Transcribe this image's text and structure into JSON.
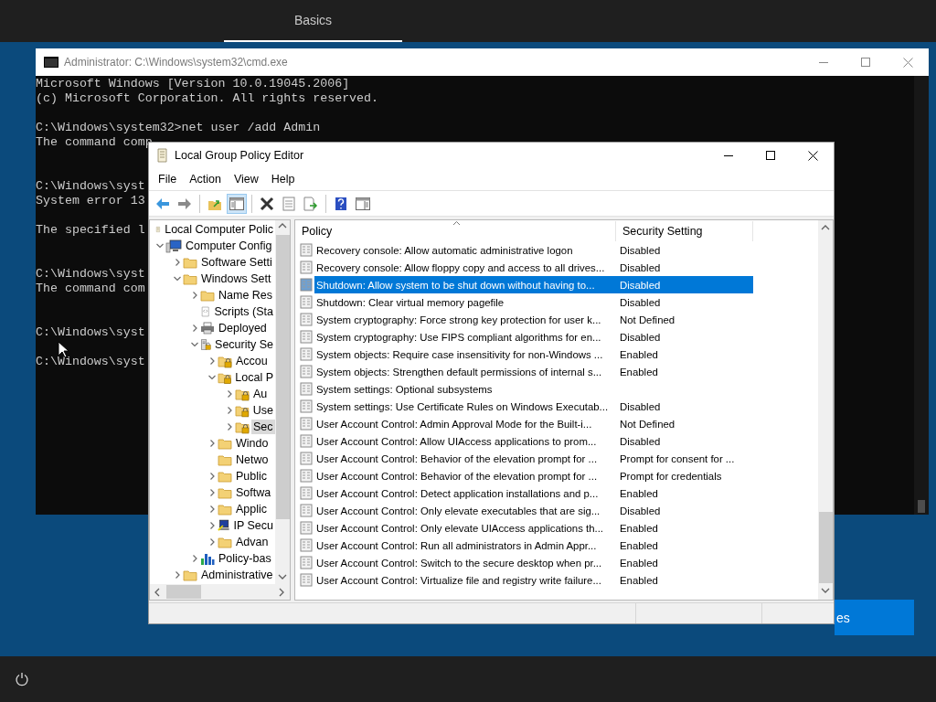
{
  "top_bar": {
    "tabs": [
      {
        "label": "Basics",
        "selected": true
      }
    ]
  },
  "cmd_window": {
    "title": "Administrator: C:\\Windows\\system32\\cmd.exe",
    "lines": [
      {
        "kind": "text",
        "text": "Microsoft Windows [Version 10.0.19045.2006]"
      },
      {
        "kind": "text",
        "text": "(c) Microsoft Corporation. All rights reserved."
      },
      {
        "kind": "blank"
      },
      {
        "kind": "text",
        "text": "C:\\Windows\\system32>net user /add Admin"
      },
      {
        "kind": "text",
        "text": "The command comp"
      },
      {
        "kind": "blank"
      },
      {
        "kind": "blank"
      },
      {
        "kind": "text",
        "text": "C:\\Windows\\syst"
      },
      {
        "kind": "text",
        "text": "System error 13"
      },
      {
        "kind": "blank"
      },
      {
        "kind": "text",
        "text": "The specified l"
      },
      {
        "kind": "blank"
      },
      {
        "kind": "blank"
      },
      {
        "kind": "text",
        "text": "C:\\Windows\\syst"
      },
      {
        "kind": "text",
        "text": "The command com"
      },
      {
        "kind": "blank"
      },
      {
        "kind": "blank"
      },
      {
        "kind": "text",
        "text": "C:\\Windows\\syst"
      },
      {
        "kind": "blank"
      },
      {
        "kind": "text",
        "text": "C:\\Windows\\syst"
      }
    ]
  },
  "background_button": {
    "label": "es"
  },
  "gpedit": {
    "title": "Local Group Policy Editor",
    "menu": [
      "File",
      "Action",
      "View",
      "Help"
    ],
    "toolbar": [
      {
        "kind": "back",
        "pressed": false
      },
      {
        "kind": "forward",
        "pressed": false
      },
      {
        "kind": "separator"
      },
      {
        "kind": "up",
        "pressed": false
      },
      {
        "kind": "tree-toggle",
        "pressed": true
      },
      {
        "kind": "separator"
      },
      {
        "kind": "delete",
        "pressed": false
      },
      {
        "kind": "properties",
        "pressed": false
      },
      {
        "kind": "export",
        "pressed": false
      },
      {
        "kind": "separator"
      },
      {
        "kind": "help",
        "pressed": false
      },
      {
        "kind": "view",
        "pressed": false
      }
    ],
    "tree": [
      {
        "label": "Local Computer Polic",
        "kind": "document",
        "selected": false,
        "children": [
          {
            "label": "Computer Config",
            "kind": "computer",
            "expanded": true,
            "selected": false,
            "children": [
              {
                "label": "Software Setti",
                "kind": "folder",
                "expanded": false,
                "selected": false
              },
              {
                "label": "Windows Sett",
                "kind": "folder",
                "expanded": true,
                "selected": false,
                "children": [
                  {
                    "label": "Name Res",
                    "kind": "folder",
                    "expanded": false,
                    "selected": false
                  },
                  {
                    "label": "Scripts (Sta",
                    "kind": "script",
                    "selected": false
                  },
                  {
                    "label": "Deployed",
                    "kind": "printer",
                    "expanded": false,
                    "selected": false
                  },
                  {
                    "label": "Security Se",
                    "kind": "secure-tool",
                    "expanded": true,
                    "selected": false,
                    "children": [
                      {
                        "label": "Accou",
                        "kind": "secure-folder",
                        "expanded": false,
                        "selected": false
                      },
                      {
                        "label": "Local P",
                        "kind": "secure-folder",
                        "expanded": true,
                        "selected": false,
                        "children": [
                          {
                            "label": "Au",
                            "kind": "secure-folder",
                            "expanded": false,
                            "selected": false
                          },
                          {
                            "label": "Use",
                            "kind": "secure-folder",
                            "expanded": false,
                            "selected": false
                          },
                          {
                            "label": "Sec",
                            "kind": "secure-folder",
                            "expanded": false,
                            "selected": true
                          }
                        ]
                      },
                      {
                        "label": "Windo",
                        "kind": "folder",
                        "expanded": false,
                        "selected": false
                      },
                      {
                        "label": "Netwo",
                        "kind": "folder",
                        "selected": false
                      },
                      {
                        "label": "Public",
                        "kind": "folder",
                        "expanded": false,
                        "selected": false
                      },
                      {
                        "label": "Softwa",
                        "kind": "folder",
                        "expanded": false,
                        "selected": false
                      },
                      {
                        "label": "Applic",
                        "kind": "folder",
                        "expanded": false,
                        "selected": false
                      },
                      {
                        "label": "IP Secu",
                        "kind": "network",
                        "expanded": false,
                        "selected": false
                      },
                      {
                        "label": "Advan",
                        "kind": "folder",
                        "expanded": false,
                        "selected": false
                      }
                    ]
                  },
                  {
                    "label": "Policy-bas",
                    "kind": "chart",
                    "expanded": false,
                    "selected": false
                  }
                ]
              },
              {
                "label": "Administrative",
                "kind": "folder",
                "expanded": false,
                "selected": false
              }
            ]
          }
        ]
      }
    ],
    "columns": [
      "Policy",
      "Security Setting"
    ],
    "rows": [
      {
        "policy": "Recovery console: Allow automatic administrative logon",
        "setting": "Disabled",
        "selected": false
      },
      {
        "policy": "Recovery console: Allow floppy copy and access to all drives...",
        "setting": "Disabled",
        "selected": false
      },
      {
        "policy": "Shutdown: Allow system to be shut down without having to...",
        "setting": "Disabled",
        "selected": true
      },
      {
        "policy": "Shutdown: Clear virtual memory pagefile",
        "setting": "Disabled",
        "selected": false
      },
      {
        "policy": "System cryptography: Force strong key protection for user k...",
        "setting": "Not Defined",
        "selected": false
      },
      {
        "policy": "System cryptography: Use FIPS compliant algorithms for en...",
        "setting": "Disabled",
        "selected": false
      },
      {
        "policy": "System objects: Require case insensitivity for non-Windows ...",
        "setting": "Enabled",
        "selected": false
      },
      {
        "policy": "System objects: Strengthen default permissions of internal s...",
        "setting": "Enabled",
        "selected": false
      },
      {
        "policy": "System settings: Optional subsystems",
        "selected": false
      },
      {
        "policy": "System settings: Use Certificate Rules on Windows Executab...",
        "setting": "Disabled",
        "selected": false
      },
      {
        "policy": "User Account Control: Admin Approval Mode for the Built-i...",
        "setting": "Not Defined",
        "selected": false
      },
      {
        "policy": "User Account Control: Allow UIAccess applications to prom...",
        "setting": "Disabled",
        "selected": false
      },
      {
        "policy": "User Account Control: Behavior of the elevation prompt for ...",
        "setting": "Prompt for consent for ...",
        "selected": false
      },
      {
        "policy": "User Account Control: Behavior of the elevation prompt for ...",
        "setting": "Prompt for credentials",
        "selected": false
      },
      {
        "policy": "User Account Control: Detect application installations and p...",
        "setting": "Enabled",
        "selected": false
      },
      {
        "policy": "User Account Control: Only elevate executables that are sig...",
        "setting": "Disabled",
        "selected": false
      },
      {
        "policy": "User Account Control: Only elevate UIAccess applications th...",
        "setting": "Enabled",
        "selected": false
      },
      {
        "policy": "User Account Control: Run all administrators in Admin Appr...",
        "setting": "Enabled",
        "selected": false
      },
      {
        "policy": "User Account Control: Switch to the secure desktop when pr...",
        "setting": "Enabled",
        "selected": false
      },
      {
        "policy": "User Account Control: Virtualize file and registry write failure...",
        "setting": "Enabled",
        "selected": false
      }
    ]
  }
}
